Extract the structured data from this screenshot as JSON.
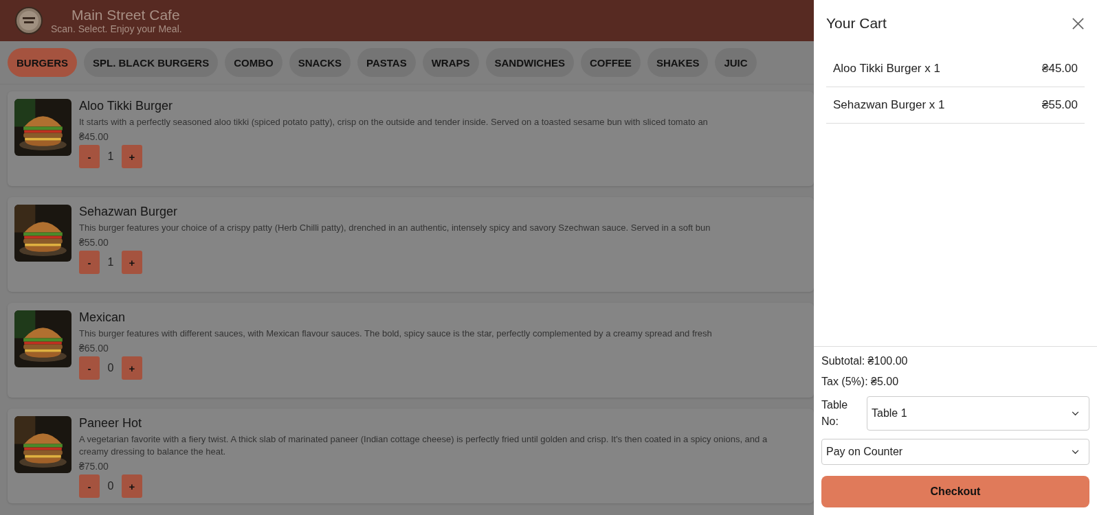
{
  "header": {
    "title": "Main Street Cafe",
    "tagline": "Scan. Select. Enjoy your Meal."
  },
  "categories": [
    {
      "label": "BURGERS",
      "selected": true
    },
    {
      "label": "SPL. BLACK BURGERS",
      "selected": false
    },
    {
      "label": "COMBO",
      "selected": false
    },
    {
      "label": "SNACKS",
      "selected": false
    },
    {
      "label": "PASTAS",
      "selected": false
    },
    {
      "label": "WRAPS",
      "selected": false
    },
    {
      "label": "SANDWICHES",
      "selected": false
    },
    {
      "label": "COFFEE",
      "selected": false
    },
    {
      "label": "SHAKES",
      "selected": false
    },
    {
      "label": "JUIC",
      "selected": false
    }
  ],
  "menu_items": [
    {
      "name": "Aloo Tikki Burger",
      "description": "It starts with a perfectly seasoned aloo tikki (spiced potato patty), crisp on the outside and tender inside. Served on a toasted sesame bun with sliced tomato an",
      "price": "₴45.00",
      "quantity": "1",
      "decrement": "-",
      "increment": "+"
    },
    {
      "name": "Sehazwan Burger",
      "description": "This burger features your choice of a crispy patty (Herb Chilli patty), drenched in an authentic, intensely spicy and savory Szechwan sauce. Served in a soft bun",
      "price": "₴55.00",
      "quantity": "1",
      "decrement": "-",
      "increment": "+"
    },
    {
      "name": "Mexican",
      "description": "This burger features with different sauces, with Mexican flavour sauces. The bold, spicy sauce is the star, perfectly complemented by a creamy spread and fresh",
      "price": "₴65.00",
      "quantity": "0",
      "decrement": "-",
      "increment": "+"
    },
    {
      "name": "Paneer Hot",
      "description": "A vegetarian favorite with a fiery twist. A thick slab of marinated paneer (Indian cottage cheese) is perfectly fried until golden and crisp. It's then coated in a spicy onions, and a creamy dressing to balance the heat.",
      "price": "₴75.00",
      "quantity": "0",
      "decrement": "-",
      "increment": "+"
    }
  ],
  "cart": {
    "title": "Your Cart",
    "items": [
      {
        "label": "Aloo Tikki Burger x 1",
        "amount": "₴45.00"
      },
      {
        "label": "Sehazwan Burger x 1",
        "amount": "₴55.00"
      }
    ],
    "subtotal": "Subtotal: ₴100.00",
    "tax": "Tax (5%): ₴5.00",
    "table_label": "Table No:",
    "table_value": "Table 1",
    "payment_value": "Pay on Counter",
    "checkout": "Checkout"
  }
}
